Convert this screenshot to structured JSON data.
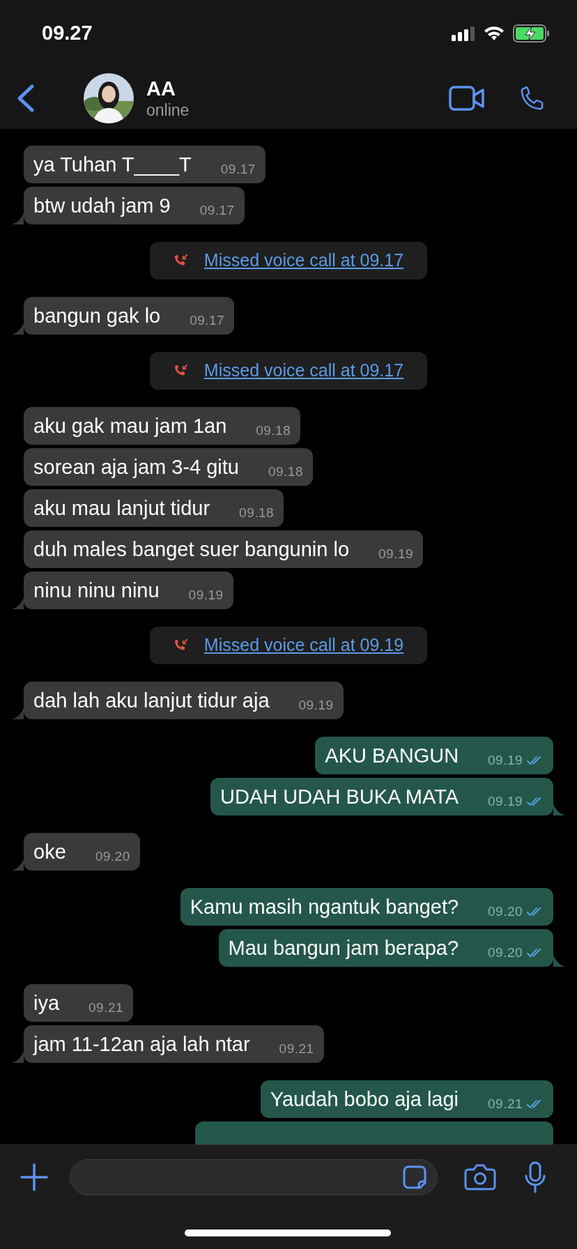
{
  "status_bar": {
    "time": "09.27"
  },
  "header": {
    "name": "AA",
    "status": "online"
  },
  "messages": [
    {
      "kind": "incoming",
      "text": "ya Tuhan T____T",
      "time": "09.17",
      "tail": false
    },
    {
      "kind": "incoming",
      "text": "btw udah jam 9",
      "time": "09.17",
      "tail": true
    },
    {
      "kind": "missed_call",
      "text": "Missed voice call at 09.17"
    },
    {
      "kind": "incoming",
      "text": "bangun gak lo",
      "time": "09.17",
      "tail": true
    },
    {
      "kind": "missed_call",
      "text": "Missed voice call at 09.17"
    },
    {
      "kind": "incoming",
      "text": "aku gak mau jam 1an",
      "time": "09.18",
      "tail": false
    },
    {
      "kind": "incoming",
      "text": "sorean aja jam 3-4 gitu",
      "time": "09.18",
      "tail": false
    },
    {
      "kind": "incoming",
      "text": "aku mau lanjut tidur",
      "time": "09.18",
      "tail": false
    },
    {
      "kind": "incoming",
      "text": "duh males banget suer bangunin lo",
      "time": "09.19",
      "tail": false
    },
    {
      "kind": "incoming",
      "text": "ninu ninu ninu",
      "time": "09.19",
      "tail": true
    },
    {
      "kind": "missed_call",
      "text": "Missed voice call at 09.19"
    },
    {
      "kind": "incoming",
      "text": "dah lah aku lanjut tidur aja",
      "time": "09.19",
      "tail": true
    },
    {
      "kind": "outgoing",
      "text": "AKU BANGUN",
      "time": "09.19",
      "tail": false,
      "read": true
    },
    {
      "kind": "outgoing",
      "text": "UDAH UDAH BUKA MATA",
      "time": "09.19",
      "tail": true,
      "read": true
    },
    {
      "kind": "incoming",
      "text": "oke",
      "time": "09.20",
      "tail": true
    },
    {
      "kind": "outgoing",
      "text": "Kamu masih ngantuk banget?",
      "time": "09.20",
      "tail": false,
      "read": true
    },
    {
      "kind": "outgoing",
      "text": "Mau bangun jam berapa?",
      "time": "09.20",
      "tail": true,
      "read": true
    },
    {
      "kind": "incoming",
      "text": "iya",
      "time": "09.21",
      "tail": false
    },
    {
      "kind": "incoming",
      "text": "jam 11-12an aja lah ntar",
      "time": "09.21",
      "tail": true
    },
    {
      "kind": "outgoing",
      "text": "Yaudah bobo aja lagi",
      "time": "09.21",
      "tail": false,
      "read": true
    },
    {
      "kind": "outgoing_partial"
    }
  ]
}
